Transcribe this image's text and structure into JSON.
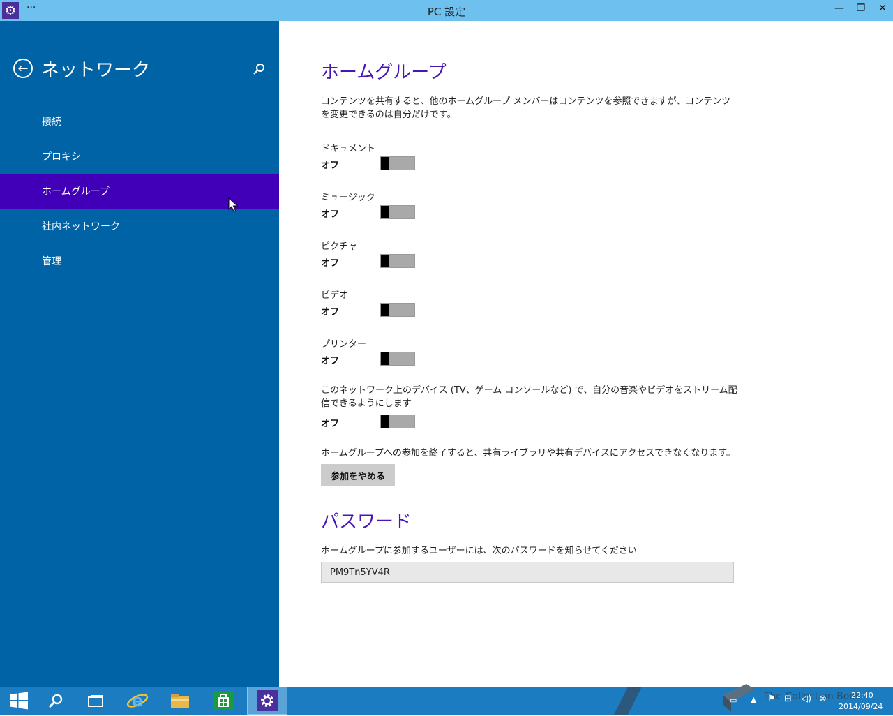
{
  "window": {
    "title": "PC 設定",
    "app_icon": "gear-icon",
    "menu_glyph": "···",
    "minimize": "—",
    "restore": "❐",
    "close": "✕"
  },
  "sidebar": {
    "back_icon": "back-arrow-icon",
    "title": "ネットワーク",
    "search_icon": "search-icon",
    "items": [
      {
        "label": "接続"
      },
      {
        "label": "プロキシ"
      },
      {
        "label": "ホームグループ",
        "selected": true
      },
      {
        "label": "社内ネットワーク"
      },
      {
        "label": "管理"
      }
    ]
  },
  "homegroup": {
    "heading": "ホームグループ",
    "description": "コンテンツを共有すると、他のホームグループ メンバーはコンテンツを参照できますが、コンテンツを変更できるのは自分だけです。",
    "settings": [
      {
        "label": "ドキュメント",
        "state": "オフ",
        "on": false
      },
      {
        "label": "ミュージック",
        "state": "オフ",
        "on": false
      },
      {
        "label": "ピクチャ",
        "state": "オフ",
        "on": false
      },
      {
        "label": "ビデオ",
        "state": "オフ",
        "on": false
      },
      {
        "label": "プリンター",
        "state": "オフ",
        "on": false
      }
    ],
    "stream_description": "このネットワーク上のデバイス (TV、ゲーム コンソールなど) で、自分の音楽やビデオをストリーム配信できるようにします",
    "stream_state": "オフ",
    "leave_description": "ホームグループへの参加を終了すると、共有ライブラリや共有デバイスにアクセスできなくなります。",
    "leave_button": "参加をやめる"
  },
  "password": {
    "heading": "パスワード",
    "description": "ホームグループに参加するユーザーには、次のパスワードを知らせてください",
    "value": "PM9Tn5YV4R"
  },
  "taskbar": {
    "items": [
      "start-icon",
      "search-icon",
      "task-view-icon",
      "internet-explorer-icon",
      "file-explorer-icon",
      "store-icon",
      "settings-icon"
    ],
    "clock_time": "22:40",
    "clock_date": "2014/09/24",
    "watermark": "The Collection Book"
  },
  "colors": {
    "sidebar_bg": "#0063a5",
    "selected_nav_bg": "#4100b8",
    "heading": "#4617b4",
    "titlebar_bg": "#6ec0ee",
    "taskbar_bg": "#1c7cc1"
  }
}
